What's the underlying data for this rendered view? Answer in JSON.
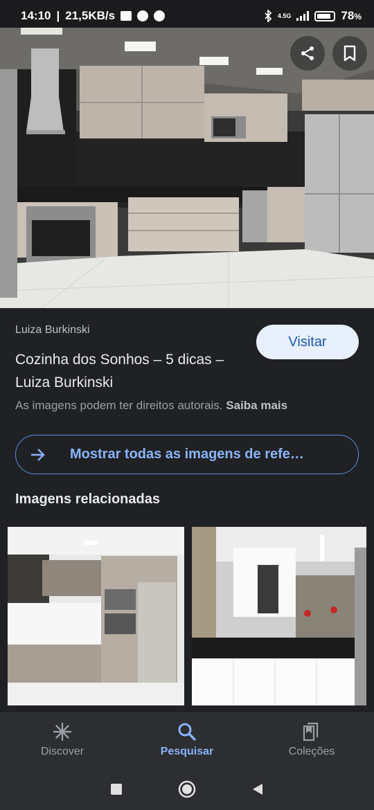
{
  "status_bar": {
    "time": "14:10",
    "speed": "21,5KB/s",
    "network": "4.5G",
    "battery": "78",
    "battery_unit": "%"
  },
  "hero": {
    "share_icon": "share-icon",
    "bookmark_icon": "bookmark-icon"
  },
  "result": {
    "source": "Luiza Burkinski",
    "title": "Cozinha dos Sonhos – 5 dicas – Luiza Burkinski",
    "visit_label": "Visitar",
    "copyright_text": "As imagens podem ter direitos autorais.",
    "learn_more": "Saiba mais"
  },
  "show_all": {
    "label": "Mostrar todas as imagens de refe…",
    "icon": "arrow-right-icon"
  },
  "related": {
    "heading": "Imagens relacionadas"
  },
  "bottom_nav": {
    "items": [
      {
        "label": "Discover",
        "icon": "asterisk-icon"
      },
      {
        "label": "Pesquisar",
        "icon": "search-icon"
      },
      {
        "label": "Coleções",
        "icon": "collections-icon"
      }
    ],
    "active_color": "#8ab4f8",
    "inactive_color": "#9aa0a6"
  }
}
